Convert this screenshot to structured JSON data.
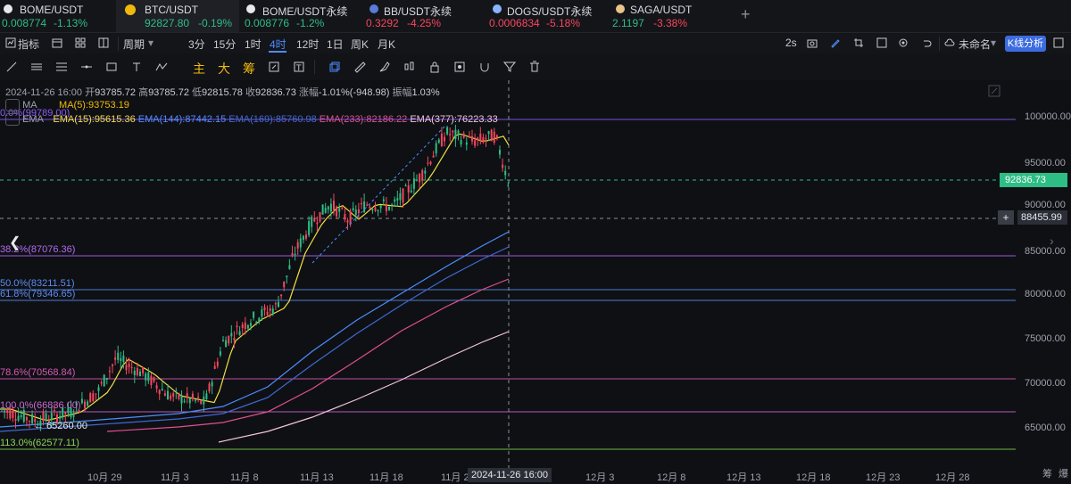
{
  "tabs": [
    {
      "symbol": "BOME/USDT",
      "price": "0.008774",
      "change": "-1.13%",
      "dir": "up",
      "icon_color": "#e6e8ec"
    },
    {
      "symbol": "BTC/USDT",
      "price": "92827.80",
      "change": "-0.19%",
      "dir": "up",
      "icon_color": "#f0b90b",
      "active": true
    },
    {
      "symbol": "BOME/USDT永续",
      "price": "0.008776",
      "change": "-1.2%",
      "dir": "up",
      "icon_color": "#e6e8ec"
    },
    {
      "symbol": "BB/USDT永续",
      "price": "0.3292",
      "change": "-4.25%",
      "dir": "dn",
      "icon_color": "#5a7bd6"
    },
    {
      "symbol": "DOGS/USDT永续",
      "price": "0.0006834",
      "change": "-5.18%",
      "dir": "dn",
      "icon_color": "#8ab4ff"
    },
    {
      "symbol": "SAGA/USDT",
      "price": "2.1197",
      "change": "-3.38%",
      "dir": "up",
      "icon_color": "#e8c38a"
    }
  ],
  "toolbar": {
    "indicators": "指标",
    "period_label": "周期",
    "intervals": [
      "3分",
      "15分",
      "1时",
      "4时",
      "12时",
      "1日",
      "周K",
      "月K"
    ],
    "active_interval": "4时",
    "refresh": "2s",
    "layout_name": "未命名",
    "kline_button": "K线分析"
  },
  "drawbar": {
    "chars": [
      "主",
      "大",
      "筹"
    ]
  },
  "info": {
    "date": "2024-11-26 16:00",
    "open_label": "开",
    "open": "93785.72",
    "high_label": "高",
    "high": "93785.72",
    "low_label": "低",
    "low": "92815.78",
    "close_label": "收",
    "close": "92836.73",
    "change_label": "涨幅",
    "change": "-1.01%(-948.98)",
    "amp_label": "振幅",
    "amp": "1.03%"
  },
  "legend": {
    "ma_title": "MA",
    "ma5": "MA(5):93753.19",
    "ema_title": "EMA",
    "ema15": "EMA(15):95615.36",
    "ema144": "EMA(144):87442.15",
    "ema169": "EMA(169):85760.98",
    "ema233": "EMA(233):82186.22",
    "ema377": "EMA(377):76223.33"
  },
  "fib_labels": [
    {
      "text": "0.0%(99789.00)",
      "color": "#8a5cf6"
    },
    {
      "text": "38.2%(87076.36)",
      "color": "#b36bf0"
    },
    {
      "text": "50.0%(83211.51)",
      "color": "#5c8cf0"
    },
    {
      "text": "61.8%(79346.65)",
      "color": "#5c8cf0"
    },
    {
      "text": "78.6%(70568.84)",
      "color": "#d65ab5"
    },
    {
      "text": "100.0%(66836.00)",
      "color": "#c76ad0"
    },
    {
      "text": "113.0%(62577.11)",
      "color": "#8bd65a"
    }
  ],
  "low_marker": "← 65260.00",
  "price_axis": [
    "100000.00",
    "95000.00",
    "90000.00",
    "85000.00",
    "80000.00",
    "75000.00",
    "70000.00",
    "65000.00"
  ],
  "current_price": "92836.73",
  "crosshair_price": "88455.99",
  "date_axis": [
    "10月 29",
    "11月 3",
    "11月 8",
    "11月 13",
    "11月 18",
    "11月 2",
    "12月 3",
    "12月 8",
    "12月 13",
    "12月 18",
    "12月 23",
    "12月 28"
  ],
  "crosshair_time": "2024-11-26 16:00",
  "corner_glyph": "筹",
  "corner_glyph2": "爆",
  "colors": {
    "up": "#2ebd85",
    "down": "#f6465d",
    "accent": "#3c6be0"
  }
}
